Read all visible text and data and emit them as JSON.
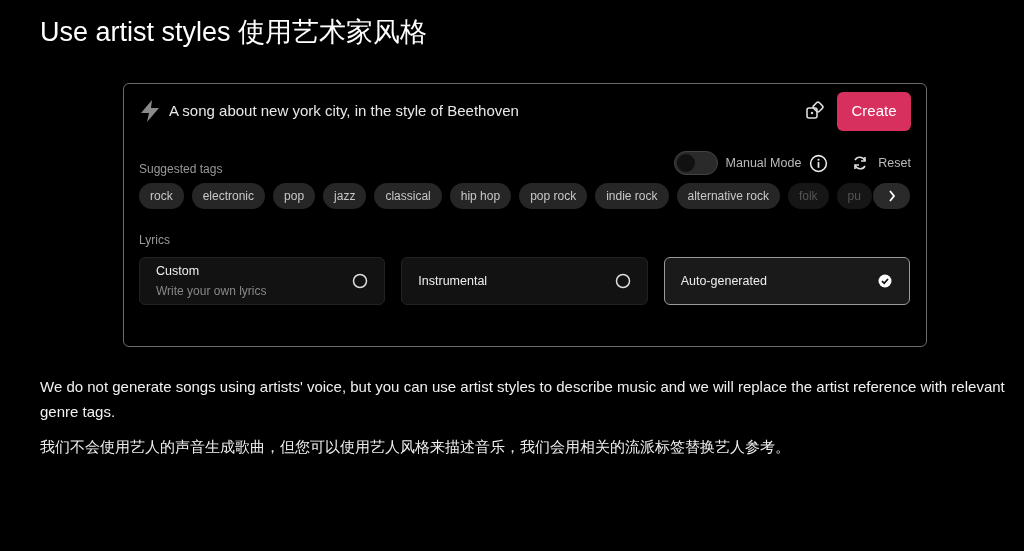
{
  "heading": "Use artist styles 使用艺术家风格",
  "prompt": {
    "value": "A song about new york city, in the style of Beethoven"
  },
  "create_button": "Create",
  "manual_mode": {
    "label": "Manual Mode",
    "on": false
  },
  "reset_button": "Reset",
  "suggested_tags": {
    "label": "Suggested tags",
    "tags": [
      {
        "label": "rock",
        "dimmed": false
      },
      {
        "label": "electronic",
        "dimmed": false
      },
      {
        "label": "pop",
        "dimmed": false
      },
      {
        "label": "jazz",
        "dimmed": false
      },
      {
        "label": "classical",
        "dimmed": false
      },
      {
        "label": "hip hop",
        "dimmed": false
      },
      {
        "label": "pop rock",
        "dimmed": false
      },
      {
        "label": "indie rock",
        "dimmed": false
      },
      {
        "label": "alternative rock",
        "dimmed": false
      },
      {
        "label": "folk",
        "dimmed": true
      },
      {
        "label": "pu",
        "dimmed": true
      }
    ]
  },
  "lyrics": {
    "label": "Lyrics",
    "options": [
      {
        "title": "Custom",
        "subtitle": "Write your own lyrics",
        "selected": false
      },
      {
        "title": "Instrumental",
        "selected": false
      },
      {
        "title": "Auto-generated",
        "selected": true
      }
    ]
  },
  "notes": [
    "We do not generate songs using artists' voice, but you can use artist styles to describe music and we will replace the artist reference with relevant genre tags.",
    "我们不会使用艺人的声音生成歌曲，但您可以使用艺人风格来描述音乐，我们会用相关的流派标签替换艺人参考。"
  ]
}
